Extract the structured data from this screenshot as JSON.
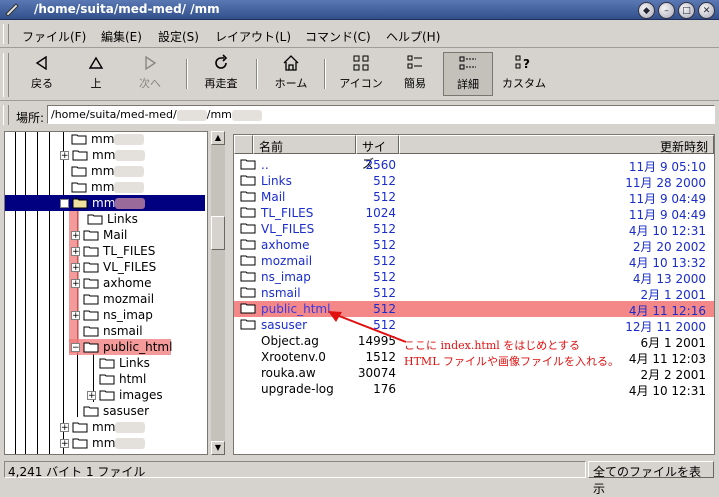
{
  "window": {
    "title": "/home/suita/med-med/      /mm"
  },
  "menu": [
    {
      "label": "ファイル(F)"
    },
    {
      "label": "編集(E)"
    },
    {
      "label": "設定(S)"
    },
    {
      "label": "レイアウト(L)"
    },
    {
      "label": "コマンド(C)"
    },
    {
      "label": "ヘルプ(H)"
    }
  ],
  "toolbar": {
    "back": "戻る",
    "up": "上",
    "forward": "次へ",
    "rescan": "再走査",
    "home": "ホーム",
    "icon_view": "アイコン",
    "brief_view": "簡易",
    "detail_view": "詳細",
    "custom_view": "カスタム"
  },
  "location": {
    "label": "場所:",
    "prefix": "/home/suita/med-med/",
    "middle": "/mm"
  },
  "tree": {
    "items": [
      {
        "label": "mm"
      },
      {
        "label": "mm"
      },
      {
        "label": "mm"
      },
      {
        "label": "mm"
      },
      {
        "label": "mm"
      },
      {
        "label": "Links"
      },
      {
        "label": "Mail"
      },
      {
        "label": "TL_FILES"
      },
      {
        "label": "VL_FILES"
      },
      {
        "label": "axhome"
      },
      {
        "label": "mozmail"
      },
      {
        "label": "ns_imap"
      },
      {
        "label": "nsmail"
      },
      {
        "label": "public_html"
      },
      {
        "label": "Links"
      },
      {
        "label": "html"
      },
      {
        "label": "images"
      },
      {
        "label": "sasuser"
      },
      {
        "label": "mm"
      },
      {
        "label": "mm"
      },
      {
        "label": "mm"
      }
    ]
  },
  "filelist": {
    "columns": {
      "name": "名前",
      "size": "サイズ",
      "modified": "更新時刻"
    },
    "rows": [
      {
        "name": "..",
        "size": "2560",
        "modified": "11月  9 05:10"
      },
      {
        "name": "Links",
        "size": "512",
        "modified": "11月 28  2000"
      },
      {
        "name": "Mail",
        "size": "512",
        "modified": "11月  9 04:49"
      },
      {
        "name": "TL_FILES",
        "size": "1024",
        "modified": "11月  9 04:49"
      },
      {
        "name": "VL_FILES",
        "size": "512",
        "modified": "4月 10 12:31"
      },
      {
        "name": "axhome",
        "size": "512",
        "modified": "2月 20  2002"
      },
      {
        "name": "mozmail",
        "size": "512",
        "modified": "4月 10 13:32"
      },
      {
        "name": "ns_imap",
        "size": "512",
        "modified": "4月 13  2000"
      },
      {
        "name": "nsmail",
        "size": "512",
        "modified": "2月  1  2001"
      },
      {
        "name": "public_html",
        "size": "512",
        "modified": "4月 11 12:16"
      },
      {
        "name": "sasuser",
        "size": "512",
        "modified": "12月 11  2000"
      },
      {
        "name": "Object.ag",
        "size": "14995",
        "modified": "6月  1  2001"
      },
      {
        "name": "Xrootenv.0",
        "size": "1512",
        "modified": "4月 11 12:03"
      },
      {
        "name": "rouka.aw",
        "size": "30074",
        "modified": "2月  2  2001"
      },
      {
        "name": "upgrade-log",
        "size": "176",
        "modified": "4月 10 12:31"
      }
    ]
  },
  "annotation": {
    "line1": "ここに index.html をはじめとする",
    "line2": "HTML ファイルや画像ファイルを入れる。"
  },
  "status": {
    "info": "4,241 バイト 1 ファイル",
    "filter": "全てのファイルを表示"
  },
  "colors": {
    "directory_text": "#1a2ccc",
    "highlight": "#f48888",
    "annotation": "#e01010",
    "selection": "#000080"
  }
}
